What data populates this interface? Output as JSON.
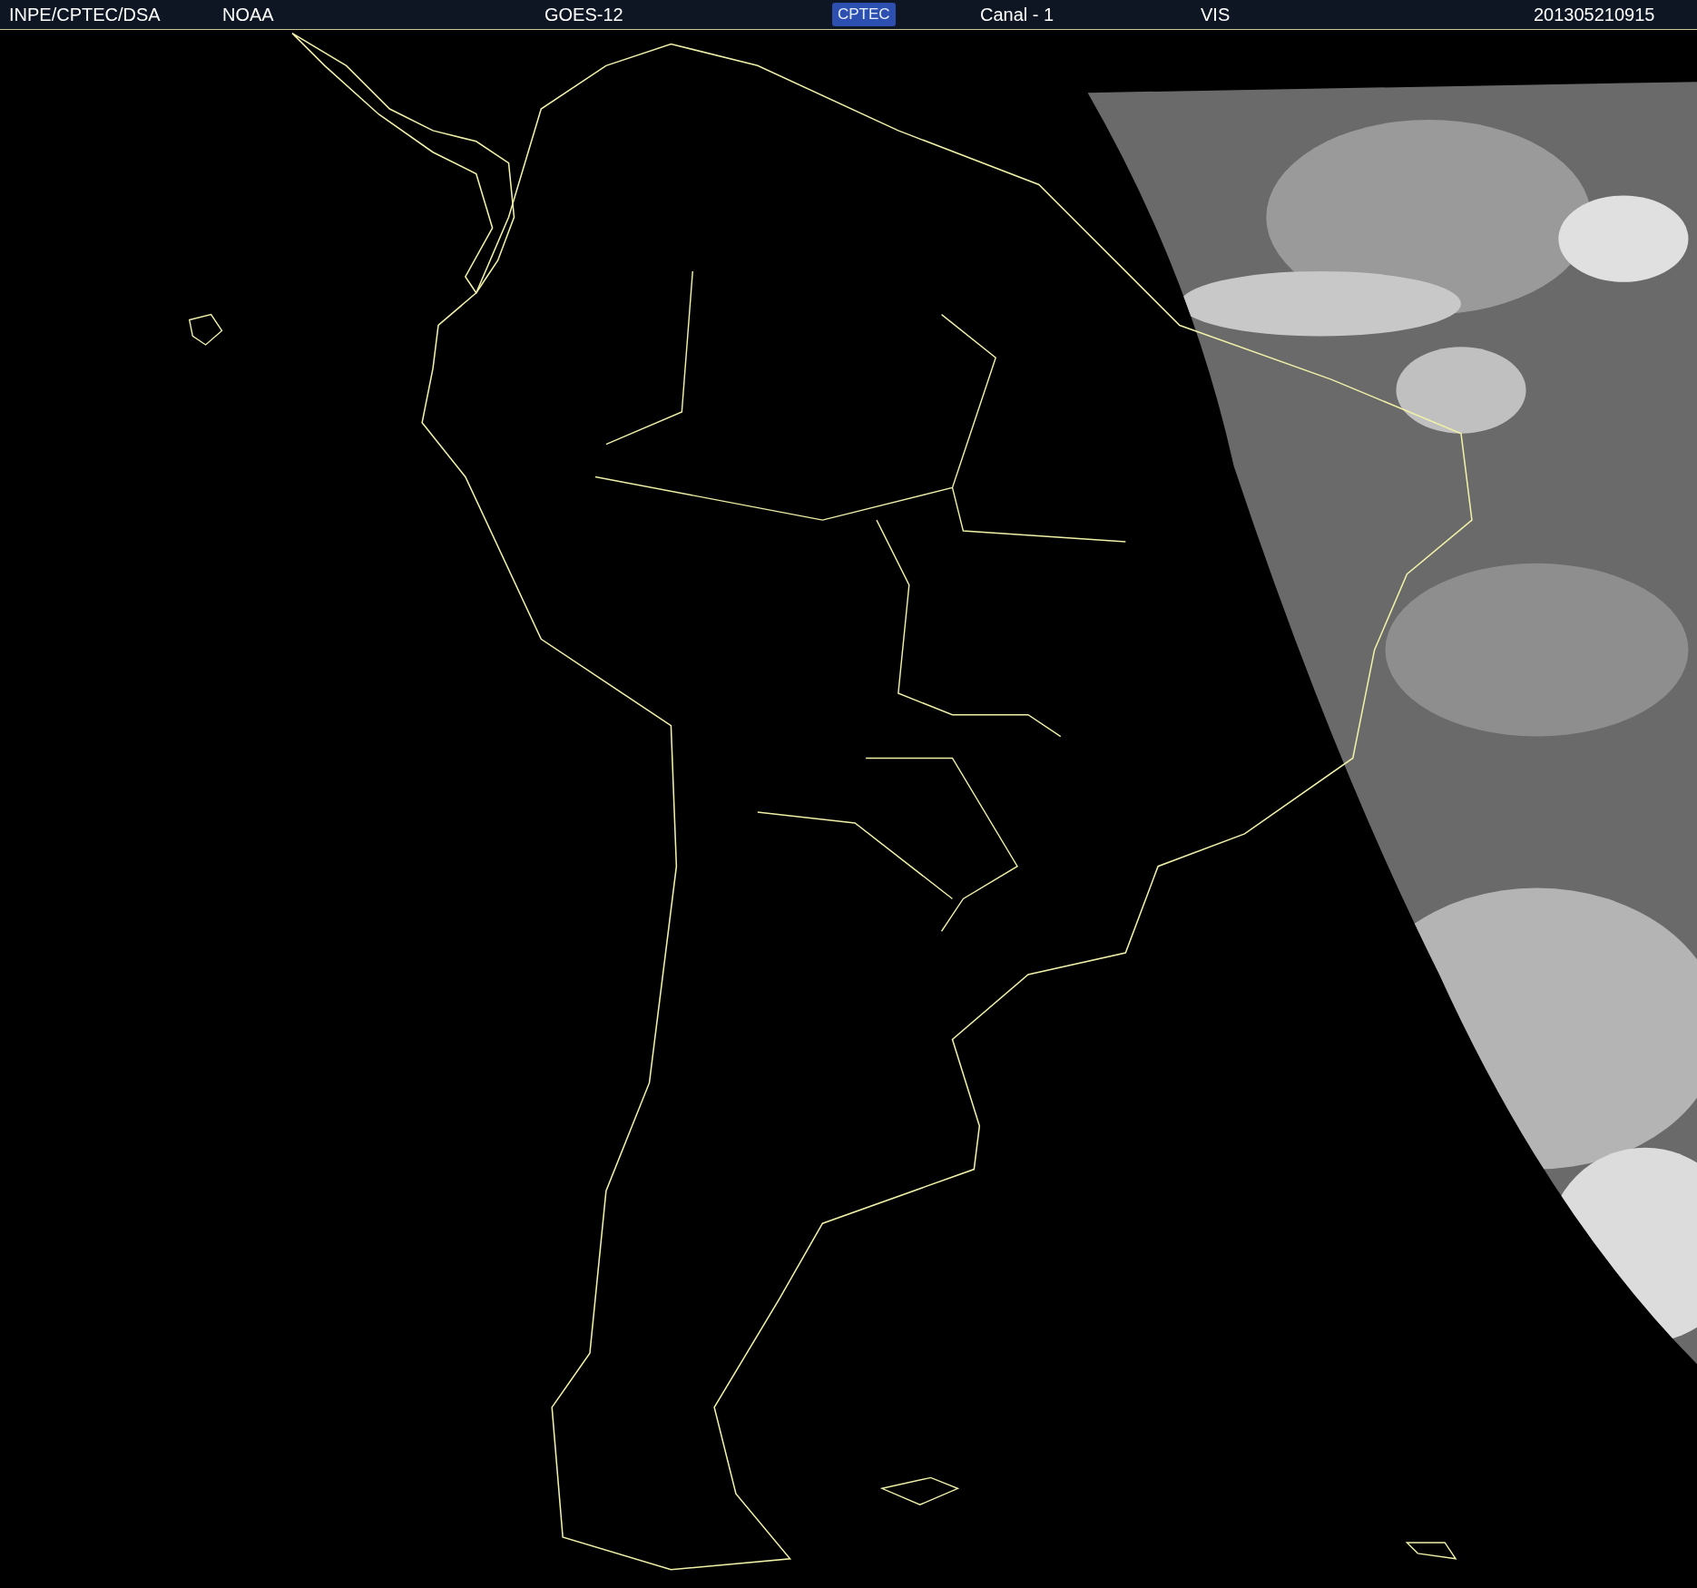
{
  "header": {
    "items": [
      {
        "kind": "text",
        "text": "INPE/CPTEC/DSA"
      },
      {
        "kind": "text",
        "text": "NOAA"
      },
      {
        "kind": "text",
        "text": "GOES-12"
      },
      {
        "kind": "logo",
        "text": "CPTEC"
      },
      {
        "kind": "text",
        "text": "Canal - 1"
      },
      {
        "kind": "text",
        "text": "VIS"
      },
      {
        "kind": "text",
        "text": "201305210915"
      }
    ]
  }
}
